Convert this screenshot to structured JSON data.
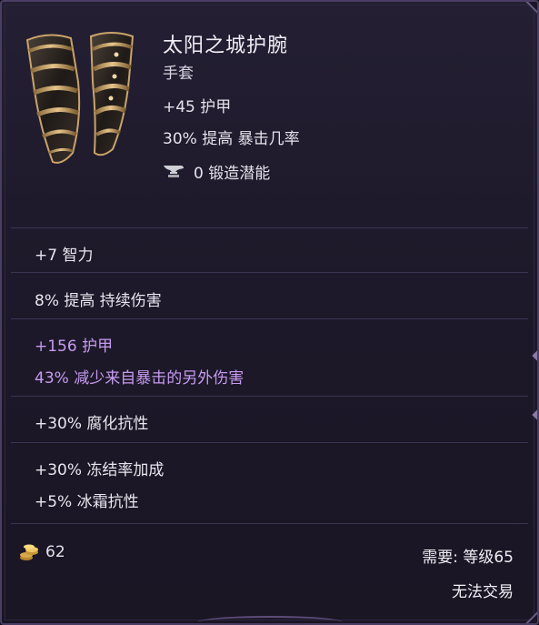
{
  "item": {
    "name": "太阳之城护腕",
    "type": "手套",
    "icon": "gauntlet-icon",
    "base_stats": [
      "+45 护甲",
      "30% 提高 暴击几率"
    ],
    "forge_potential": "0 锻造潜能",
    "forge_icon": "anvil-icon"
  },
  "affixes": [
    {
      "text": "+7 智力"
    },
    {
      "text": "8% 提高 持续伤害"
    },
    {
      "text": "+156 护甲"
    },
    {
      "text": "43% 减少来自暴击的另外伤害"
    },
    {
      "text": "+30% 腐化抗性"
    },
    {
      "text": "+30% 冻结率加成"
    },
    {
      "text": "+5% 冰霜抗性"
    }
  ],
  "footer": {
    "gold_icon": "gold-coin-icon",
    "gold_value": "62",
    "requirement": "需要: 等级65",
    "trade_status": "无法交易"
  },
  "colors": {
    "background": "#1e1a2b",
    "text": "#e9e6ef",
    "unique_affix": "#c79bf0",
    "border": "#4a3e63"
  }
}
